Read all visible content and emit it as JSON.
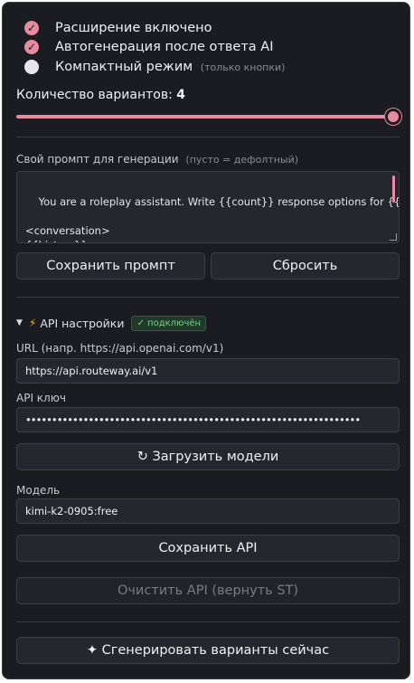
{
  "toggles": [
    {
      "label": "Расширение включено",
      "checked": true
    },
    {
      "label": "Автогенерация после ответа AI",
      "checked": true
    },
    {
      "label": "Компактный режим",
      "hint": "(только кнопки)",
      "checked": false
    }
  ],
  "variants": {
    "label": "Количество вариантов:",
    "value": "4",
    "slider_fraction": 1.0
  },
  "prompt": {
    "label": "Свой промпт для генерации",
    "hint": "(пусто = дефолтный)",
    "text": "You are a roleplay assistant. Write {{count}} response options for {{user}}.\n\n<conversation>\n{{history}}\n</conversation>"
  },
  "buttons": {
    "save_prompt": "Сохранить промпт",
    "reset": "Сбросить",
    "load_models": "↻ Загрузить модели",
    "save_api": "Сохранить API",
    "clear_api": "Очистить API (вернуть ST)",
    "generate": "✦ Сгенерировать варианты сейчас"
  },
  "api": {
    "title": "API настройки",
    "status": "✓ подключён",
    "url_label": "URL (напр. https://api.openai.com/v1)",
    "url_value": "https://api.routeway.ai/v1",
    "key_label": "API ключ",
    "key_value": "••••••••••••••••••••••••••••••••••••••••••••••••••••••••••••••••",
    "model_label": "Модель",
    "model_value": "kimi-k2-0905:free"
  },
  "icons": {
    "check": "✓",
    "triangle": "▼",
    "bolt": "⚡"
  },
  "colors": {
    "accent": "#e88aa0",
    "panel": "#1b1b22",
    "field": "#26262e",
    "status_green": "#7ad08f"
  }
}
